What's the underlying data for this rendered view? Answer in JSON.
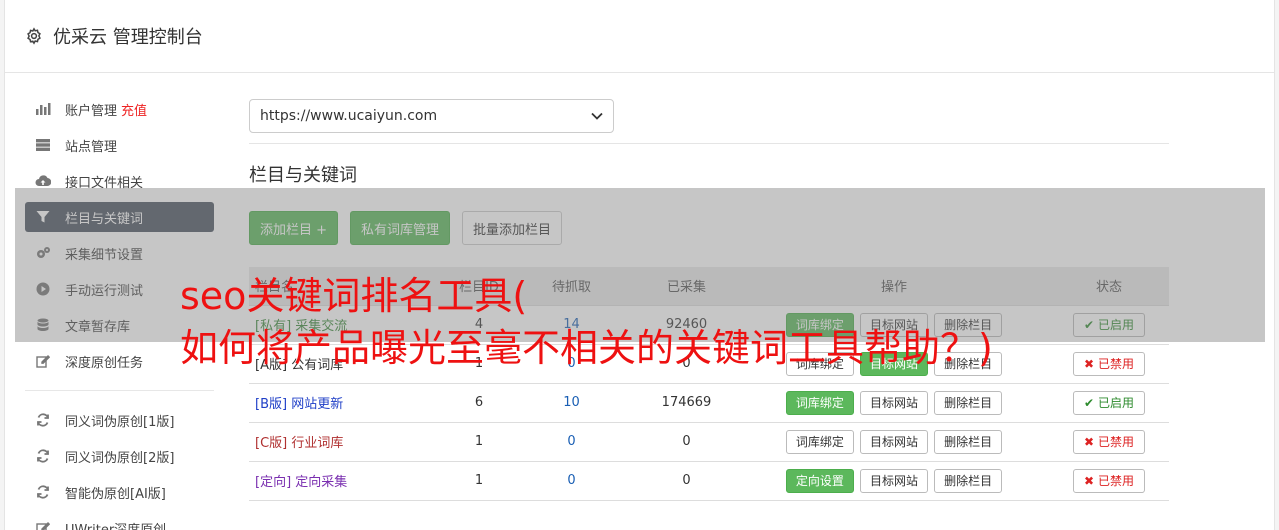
{
  "header": {
    "title": "优采云 管理控制台"
  },
  "sidebar": {
    "items": [
      {
        "label": "账户管理",
        "extra": "充值"
      },
      {
        "label": "站点管理"
      },
      {
        "label": "接口文件相关"
      },
      {
        "label": "栏目与关键词"
      },
      {
        "label": "采集细节设置"
      },
      {
        "label": "手动运行测试"
      },
      {
        "label": "文章暂存库"
      },
      {
        "label": "深度原创任务"
      },
      {
        "label": "同义词伪原创[1版]"
      },
      {
        "label": "同义词伪原创[2版]"
      },
      {
        "label": "智能伪原创[AI版]"
      },
      {
        "label": "UWriter深度原创"
      }
    ]
  },
  "main": {
    "site_select": "https://www.ucaiyun.com",
    "section_title": "栏目与关键词",
    "buttons": {
      "add": "添加栏目 +",
      "private_lib": "私有词库管理",
      "batch_add": "批量添加栏目"
    }
  },
  "table": {
    "headers": [
      "栏目名",
      "栏目ID",
      "待抓取",
      "已采集",
      "操作",
      "状态"
    ],
    "rows": [
      {
        "tag": "[私有]",
        "name": "采集交流",
        "id": "4",
        "pending": "14",
        "collected": "92460",
        "op1": "词库绑定",
        "op2": "目标网站",
        "op3": "删除栏目",
        "status": "已启用"
      },
      {
        "tag": "[A版]",
        "name": "公有词库",
        "id": "1",
        "pending": "0",
        "collected": "0",
        "op1": "词库绑定",
        "op2": "目标网站",
        "op3": "删除栏目",
        "status": "已禁用"
      },
      {
        "tag": "[B版]",
        "name": "网站更新",
        "id": "6",
        "pending": "10",
        "collected": "174669",
        "op1": "词库绑定",
        "op2": "目标网站",
        "op3": "删除栏目",
        "status": "已启用"
      },
      {
        "tag": "[C版]",
        "name": "行业词库",
        "id": "1",
        "pending": "0",
        "collected": "0",
        "op1": "词库绑定",
        "op2": "目标网站",
        "op3": "删除栏目",
        "status": "已禁用"
      },
      {
        "tag": "[定向]",
        "name": "定向采集",
        "id": "1",
        "pending": "0",
        "collected": "0",
        "op1": "定向设置",
        "op2": "目标网站",
        "op3": "删除栏目",
        "status": "已禁用"
      }
    ]
  },
  "overlay": {
    "line1": "seo关键词排名工具(",
    "line2": "如何将产品曝光至毫不相关的关键词工具帮助？)"
  },
  "colors": {
    "accent_green": "#5cb85c",
    "active_nav": "#4c5461",
    "overlay_text": "#ee1111"
  }
}
